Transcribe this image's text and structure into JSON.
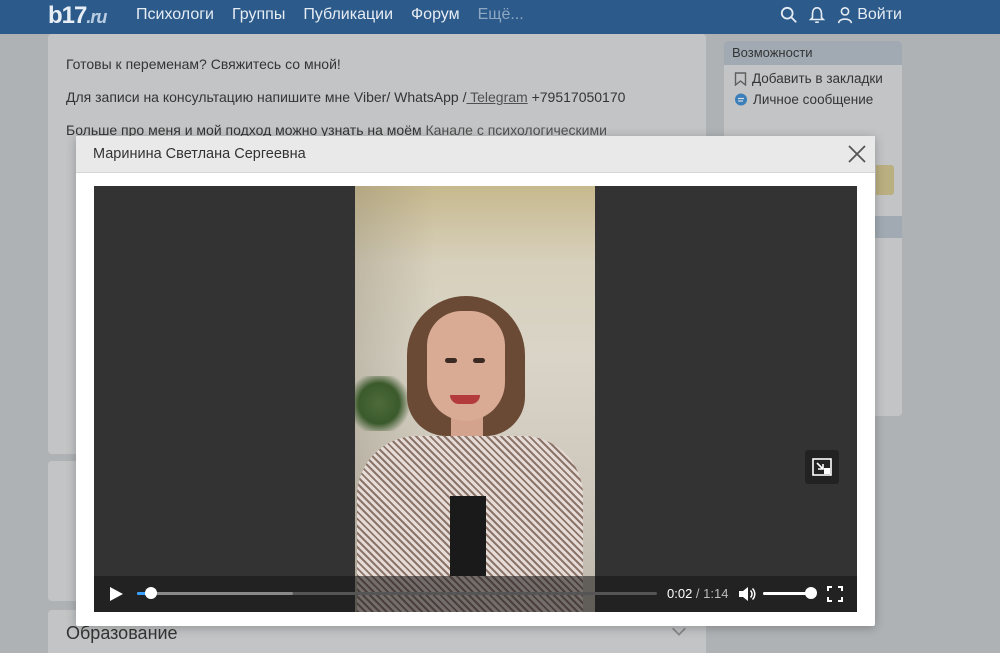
{
  "header": {
    "logo": "b17",
    "logo_suffix": ".ru",
    "nav": [
      "Психологи",
      "Группы",
      "Публикации",
      "Форум",
      "Ещё..."
    ],
    "login_label": "Войти",
    "icons": [
      "search-icon",
      "bell-icon",
      "user-icon"
    ]
  },
  "main": {
    "line1": "Готовы к переменам? Свяжитесь со мной!",
    "line2_prefix": "Для записи на консультацию напишите мне Viber/ WhatsApp /",
    "line2_link": " Telegram",
    "line2_suffix": " +79517050170",
    "line3_prefix": "Больше про меня и мой подход можно узнать на моём ",
    "line3_link": "Канале с психологическими"
  },
  "section_education": "Образование",
  "sidebar": {
    "title": "Возможности",
    "items": [
      {
        "label": "Добавить в закладки",
        "icon": "bookmark-icon"
      },
      {
        "label": "Личное сообщение",
        "icon": "chat-icon"
      }
    ]
  },
  "modal": {
    "title": "Маринина Светлана Сергеевна"
  },
  "player": {
    "current_time": "0:02",
    "separator": " / ",
    "duration": "1:14",
    "progress_fraction": 0.027,
    "buffered_fraction": 0.3,
    "volume_fraction": 1.0
  },
  "colors": {
    "nav_bg": "#2c5b8b",
    "accent": "#3aa0ff"
  }
}
